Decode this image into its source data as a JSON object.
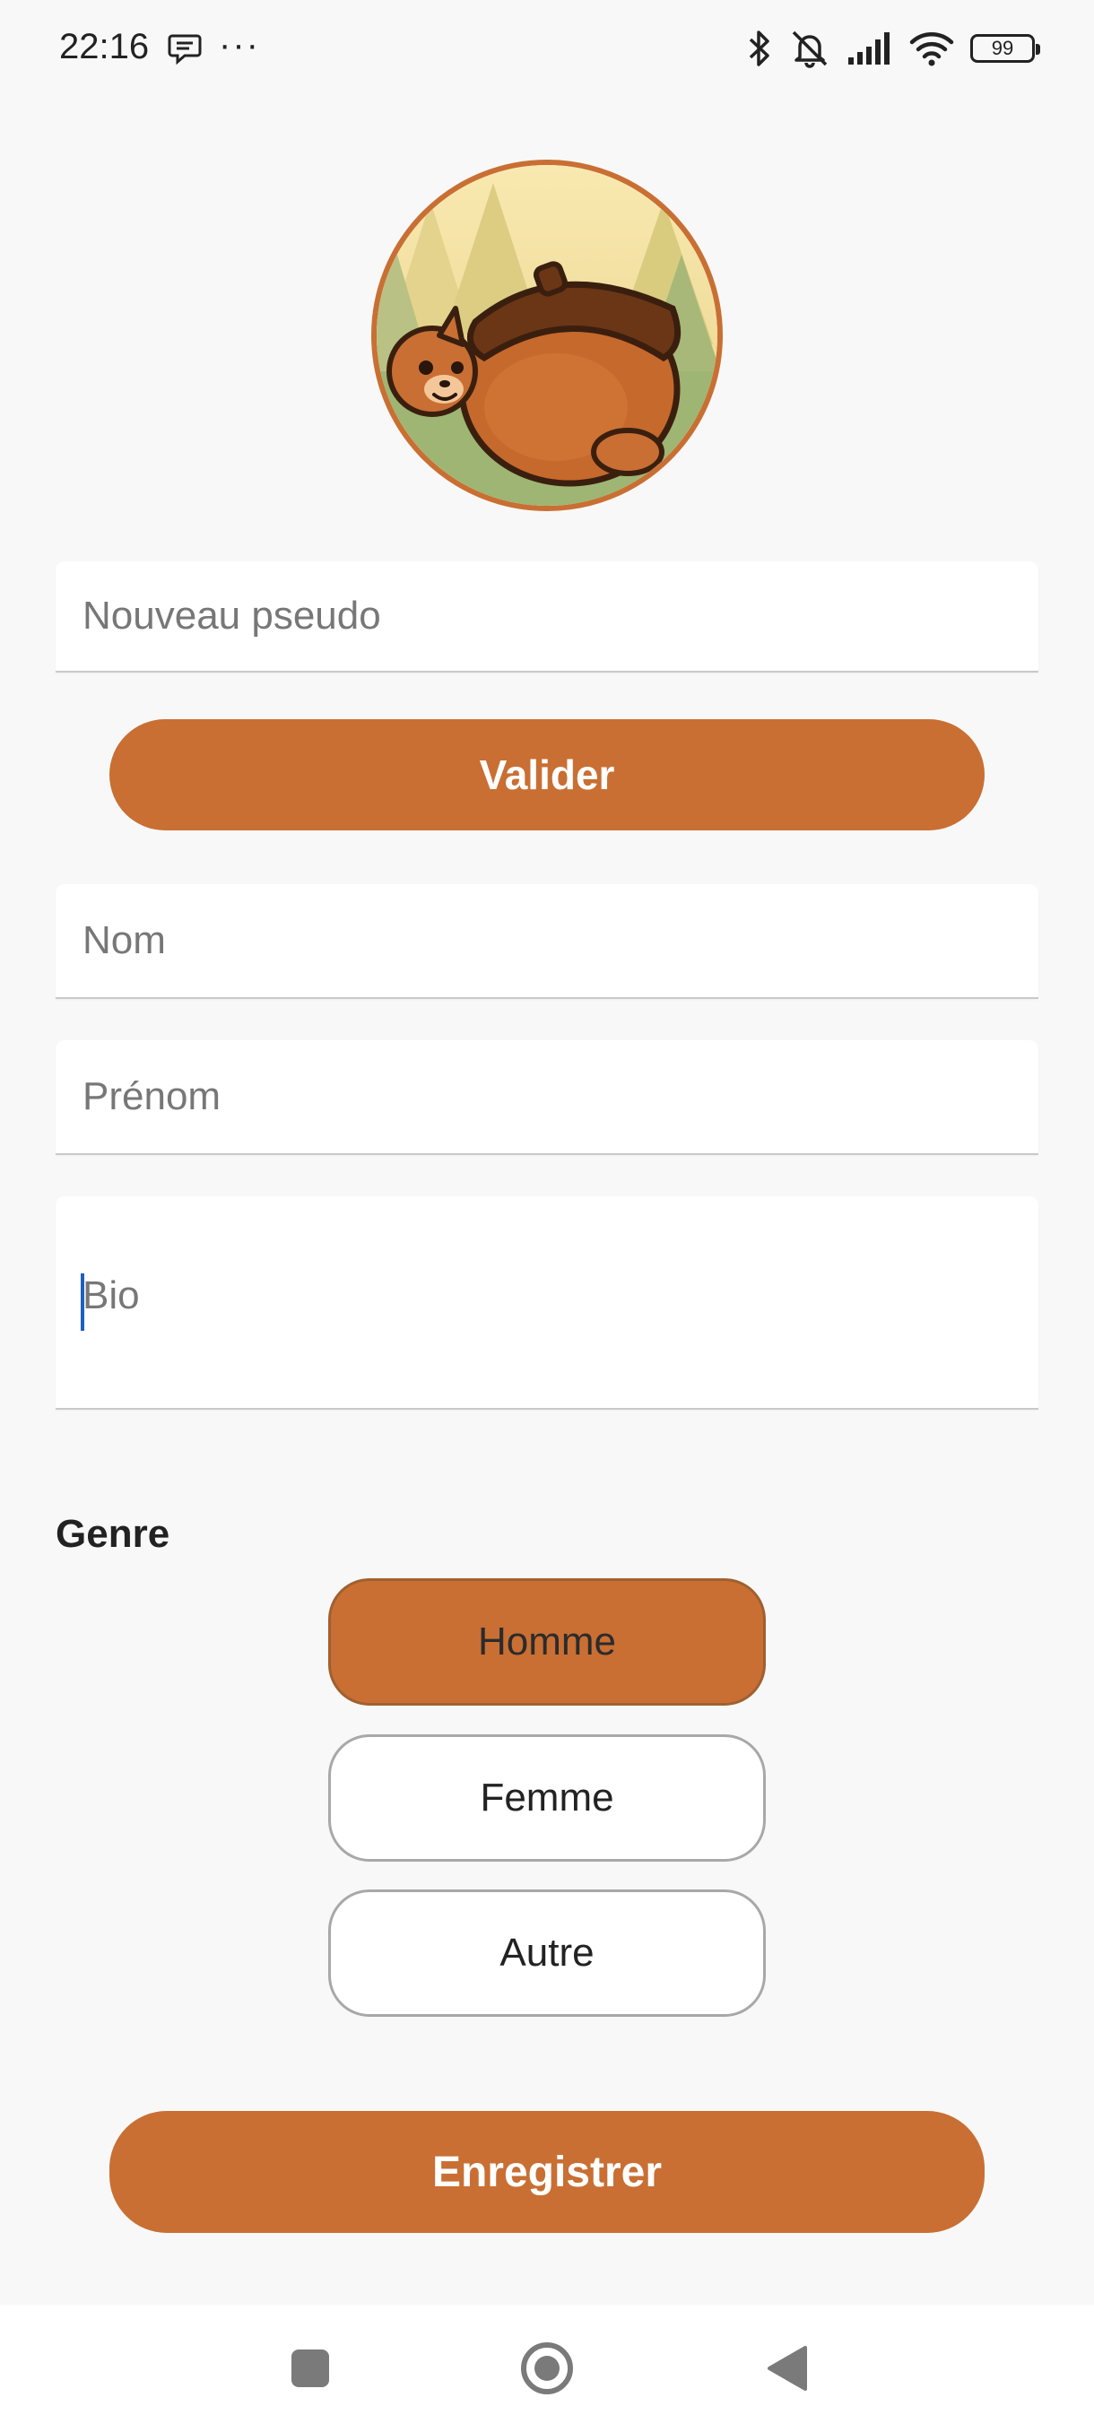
{
  "status_bar": {
    "time": "22:16",
    "dots": "···",
    "battery": "99",
    "icons": [
      "message-icon",
      "bluetooth-icon",
      "bell-off-icon",
      "signal-icon",
      "wifi-icon",
      "battery-icon"
    ]
  },
  "profile": {
    "avatar_icon": "squirrel-acorn-avatar"
  },
  "form": {
    "pseudo_placeholder": "Nouveau pseudo",
    "validate_label": "Valider",
    "nom_placeholder": "Nom",
    "prenom_placeholder": "Prénom",
    "bio_placeholder": "Bio"
  },
  "genre": {
    "label": "Genre",
    "options": [
      "Homme",
      "Femme",
      "Autre"
    ],
    "selected": "Homme"
  },
  "actions": {
    "save_label": "Enregistrer"
  },
  "colors": {
    "accent": "#c96f33",
    "background": "#f8f8f8"
  },
  "nav": {
    "icons": [
      "recents-square-icon",
      "home-circle-icon",
      "back-triangle-icon"
    ]
  }
}
